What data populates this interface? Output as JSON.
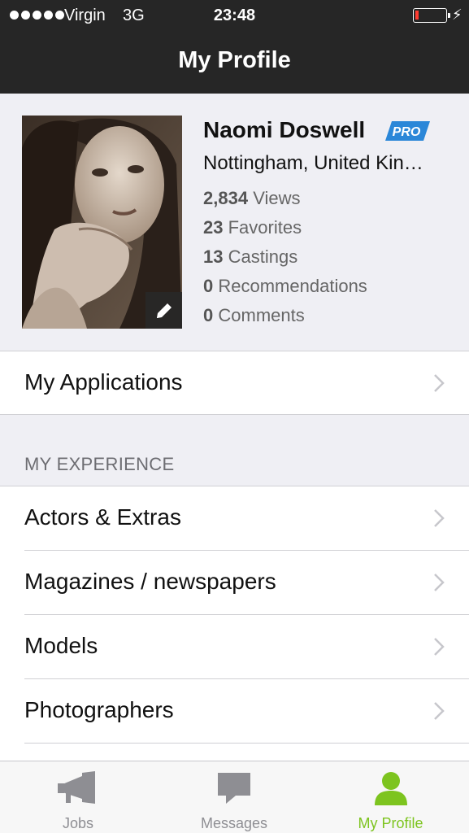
{
  "status_bar": {
    "carrier": "Virgin",
    "network": "3G",
    "time": "23:48"
  },
  "nav": {
    "title": "My Profile"
  },
  "profile": {
    "name": "Naomi Doswell",
    "badge": "PRO",
    "location": "Nottingham, United Kin…",
    "stats": [
      {
        "count": "2,834",
        "label": "Views"
      },
      {
        "count": "23",
        "label": "Favorites"
      },
      {
        "count": "13",
        "label": "Castings"
      },
      {
        "count": "0",
        "label": "Recommendations"
      },
      {
        "count": "0",
        "label": "Comments"
      }
    ]
  },
  "applications_row": {
    "label": "My Applications"
  },
  "experience": {
    "header": "MY EXPERIENCE",
    "items": [
      {
        "label": "Actors & Extras"
      },
      {
        "label": "Magazines / newspapers"
      },
      {
        "label": "Models"
      },
      {
        "label": "Photographers"
      }
    ]
  },
  "tabbar": {
    "tabs": [
      {
        "label": "Jobs",
        "icon": "megaphone-icon"
      },
      {
        "label": "Messages",
        "icon": "speech-bubble-icon"
      },
      {
        "label": "My Profile",
        "icon": "person-icon",
        "active": true
      }
    ]
  },
  "colors": {
    "accent": "#7dc41f",
    "pro_badge": "#2b87d8",
    "nav_bar": "#262626",
    "background": "#efeff4"
  }
}
